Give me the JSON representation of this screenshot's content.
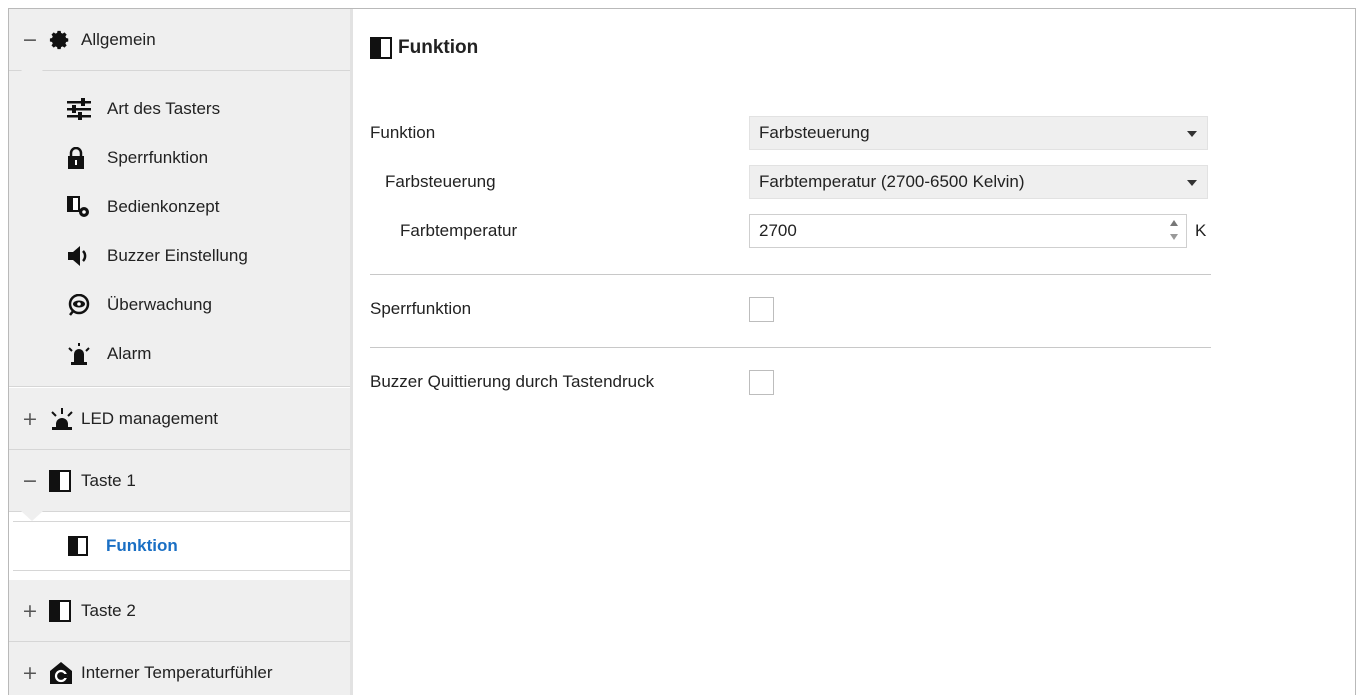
{
  "sidebar": {
    "groups": {
      "allgemein": {
        "toggle": "−",
        "label": "Allgemein",
        "icon": "gear-icon"
      },
      "led": {
        "toggle": "+",
        "label": "LED management",
        "icon": "led-icon"
      },
      "taste1": {
        "toggle": "−",
        "label": "Taste 1",
        "icon": "page-icon"
      },
      "taste2": {
        "toggle": "+",
        "label": "Taste 2",
        "icon": "page-icon"
      },
      "temp": {
        "toggle": "+",
        "label": "Interner Temperaturfühler",
        "icon": "house-temperature-icon"
      }
    },
    "allgemein_items": [
      {
        "label": "Art des Tasters",
        "icon": "sliders-icon"
      },
      {
        "label": "Sperrfunktion",
        "icon": "lock-icon"
      },
      {
        "label": "Bedienkonzept",
        "icon": "concept-gear-icon"
      },
      {
        "label": "Buzzer Einstellung",
        "icon": "speaker-icon"
      },
      {
        "label": "Überwachung",
        "icon": "eye-icon"
      },
      {
        "label": "Alarm",
        "icon": "alarm-icon"
      }
    ],
    "active_item": {
      "label": "Funktion",
      "icon": "page-icon"
    }
  },
  "main": {
    "title": "Funktion",
    "rows": {
      "funktion": {
        "label": "Funktion",
        "value": "Farbsteuerung"
      },
      "farbsteuerung": {
        "label": "Farbsteuerung",
        "value": "Farbtemperatur (2700-6500 Kelvin)"
      },
      "farbtemperatur": {
        "label": "Farbtemperatur",
        "value": "2700",
        "unit": "K"
      },
      "sperrfunktion": {
        "label": "Sperrfunktion",
        "checked": false
      },
      "buzzer": {
        "label": "Buzzer Quittierung durch Tastendruck",
        "checked": false
      }
    }
  },
  "colors": {
    "accent": "#1a6fc4",
    "sidebar_bg": "#efefef",
    "select_bg": "#efefef"
  }
}
